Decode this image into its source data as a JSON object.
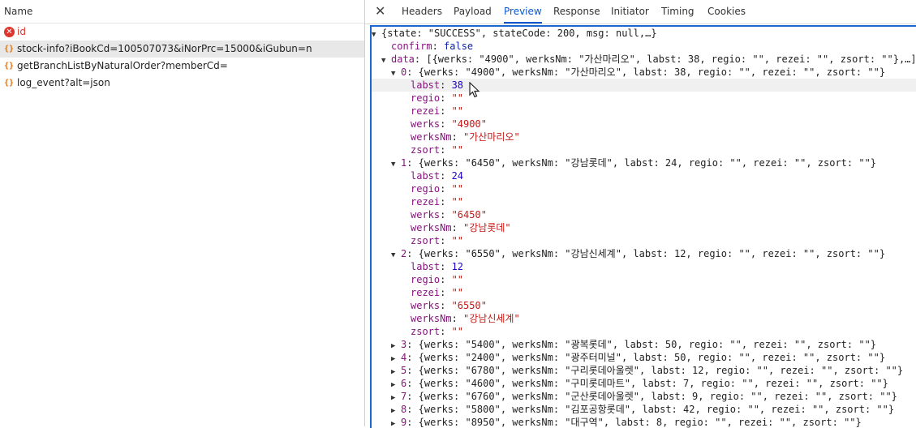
{
  "network": {
    "header": "Name",
    "requests": [
      {
        "name": "id",
        "status": "error",
        "icon": "error-icon"
      },
      {
        "name": "stock-info?iBookCd=100507073&iNorPrc=15000&iGubun=n",
        "status": "json",
        "icon": "json-icon",
        "selected": true
      },
      {
        "name": "getBranchListByNaturalOrder?memberCd=",
        "status": "json",
        "icon": "json-icon"
      },
      {
        "name": "log_event?alt=json",
        "status": "json",
        "icon": "json-icon"
      }
    ]
  },
  "details": {
    "close_icon": "close-icon",
    "close_glyph": "✕",
    "tabs": [
      "Headers",
      "Payload",
      "Preview",
      "Response",
      "Initiator",
      "Timing",
      "Cookies"
    ],
    "active_tab": "Preview"
  },
  "preview": {
    "root_summary": "{state: \"SUCCESS\", stateCode: 200, msg: null,…}",
    "confirm": "false",
    "data_summary": "[{werks: \"4900\", werksNm: \"가산마리오\", labst: 38, regio: \"\", rezei: \"\", zsort: \"\"},…]",
    "items": [
      {
        "index": "0",
        "werks": "4900",
        "werksNm": "가산마리오",
        "labst": "38",
        "regio": "",
        "rezei": "",
        "zsort": "",
        "expanded": true
      },
      {
        "index": "1",
        "werks": "6450",
        "werksNm": "강남롯데",
        "labst": "24",
        "regio": "",
        "rezei": "",
        "zsort": "",
        "expanded": true
      },
      {
        "index": "2",
        "werks": "6550",
        "werksNm": "강남신세계",
        "labst": "12",
        "regio": "",
        "rezei": "",
        "zsort": "",
        "expanded": true
      },
      {
        "index": "3",
        "werks": "5400",
        "werksNm": "광복롯데",
        "labst": "50",
        "regio": "",
        "rezei": "",
        "zsort": "",
        "expanded": false
      },
      {
        "index": "4",
        "werks": "2400",
        "werksNm": "광주터미널",
        "labst": "50",
        "regio": "",
        "rezei": "",
        "zsort": "",
        "expanded": false
      },
      {
        "index": "5",
        "werks": "6780",
        "werksNm": "구리롯데아울렛",
        "labst": "12",
        "regio": "",
        "rezei": "",
        "zsort": "",
        "expanded": false
      },
      {
        "index": "6",
        "werks": "4600",
        "werksNm": "구미롯데마트",
        "labst": "7",
        "regio": "",
        "rezei": "",
        "zsort": "",
        "expanded": false
      },
      {
        "index": "7",
        "werks": "6760",
        "werksNm": "군산롯데아울렛",
        "labst": "9",
        "regio": "",
        "rezei": "",
        "zsort": "",
        "expanded": false
      },
      {
        "index": "8",
        "werks": "5800",
        "werksNm": "김포공항롯데",
        "labst": "42",
        "regio": "",
        "rezei": "",
        "zsort": "",
        "expanded": false
      },
      {
        "index": "9",
        "werks": "8950",
        "werksNm": "대구역",
        "labst": "8",
        "regio": "",
        "rezei": "",
        "zsort": "",
        "expanded": false
      }
    ],
    "hovered_line": "labst: 38"
  },
  "colors": {
    "accent": "#1a66d2",
    "key": "#881280",
    "string": "#c41a16",
    "number": "#1c00cf",
    "error": "#dc362e"
  }
}
